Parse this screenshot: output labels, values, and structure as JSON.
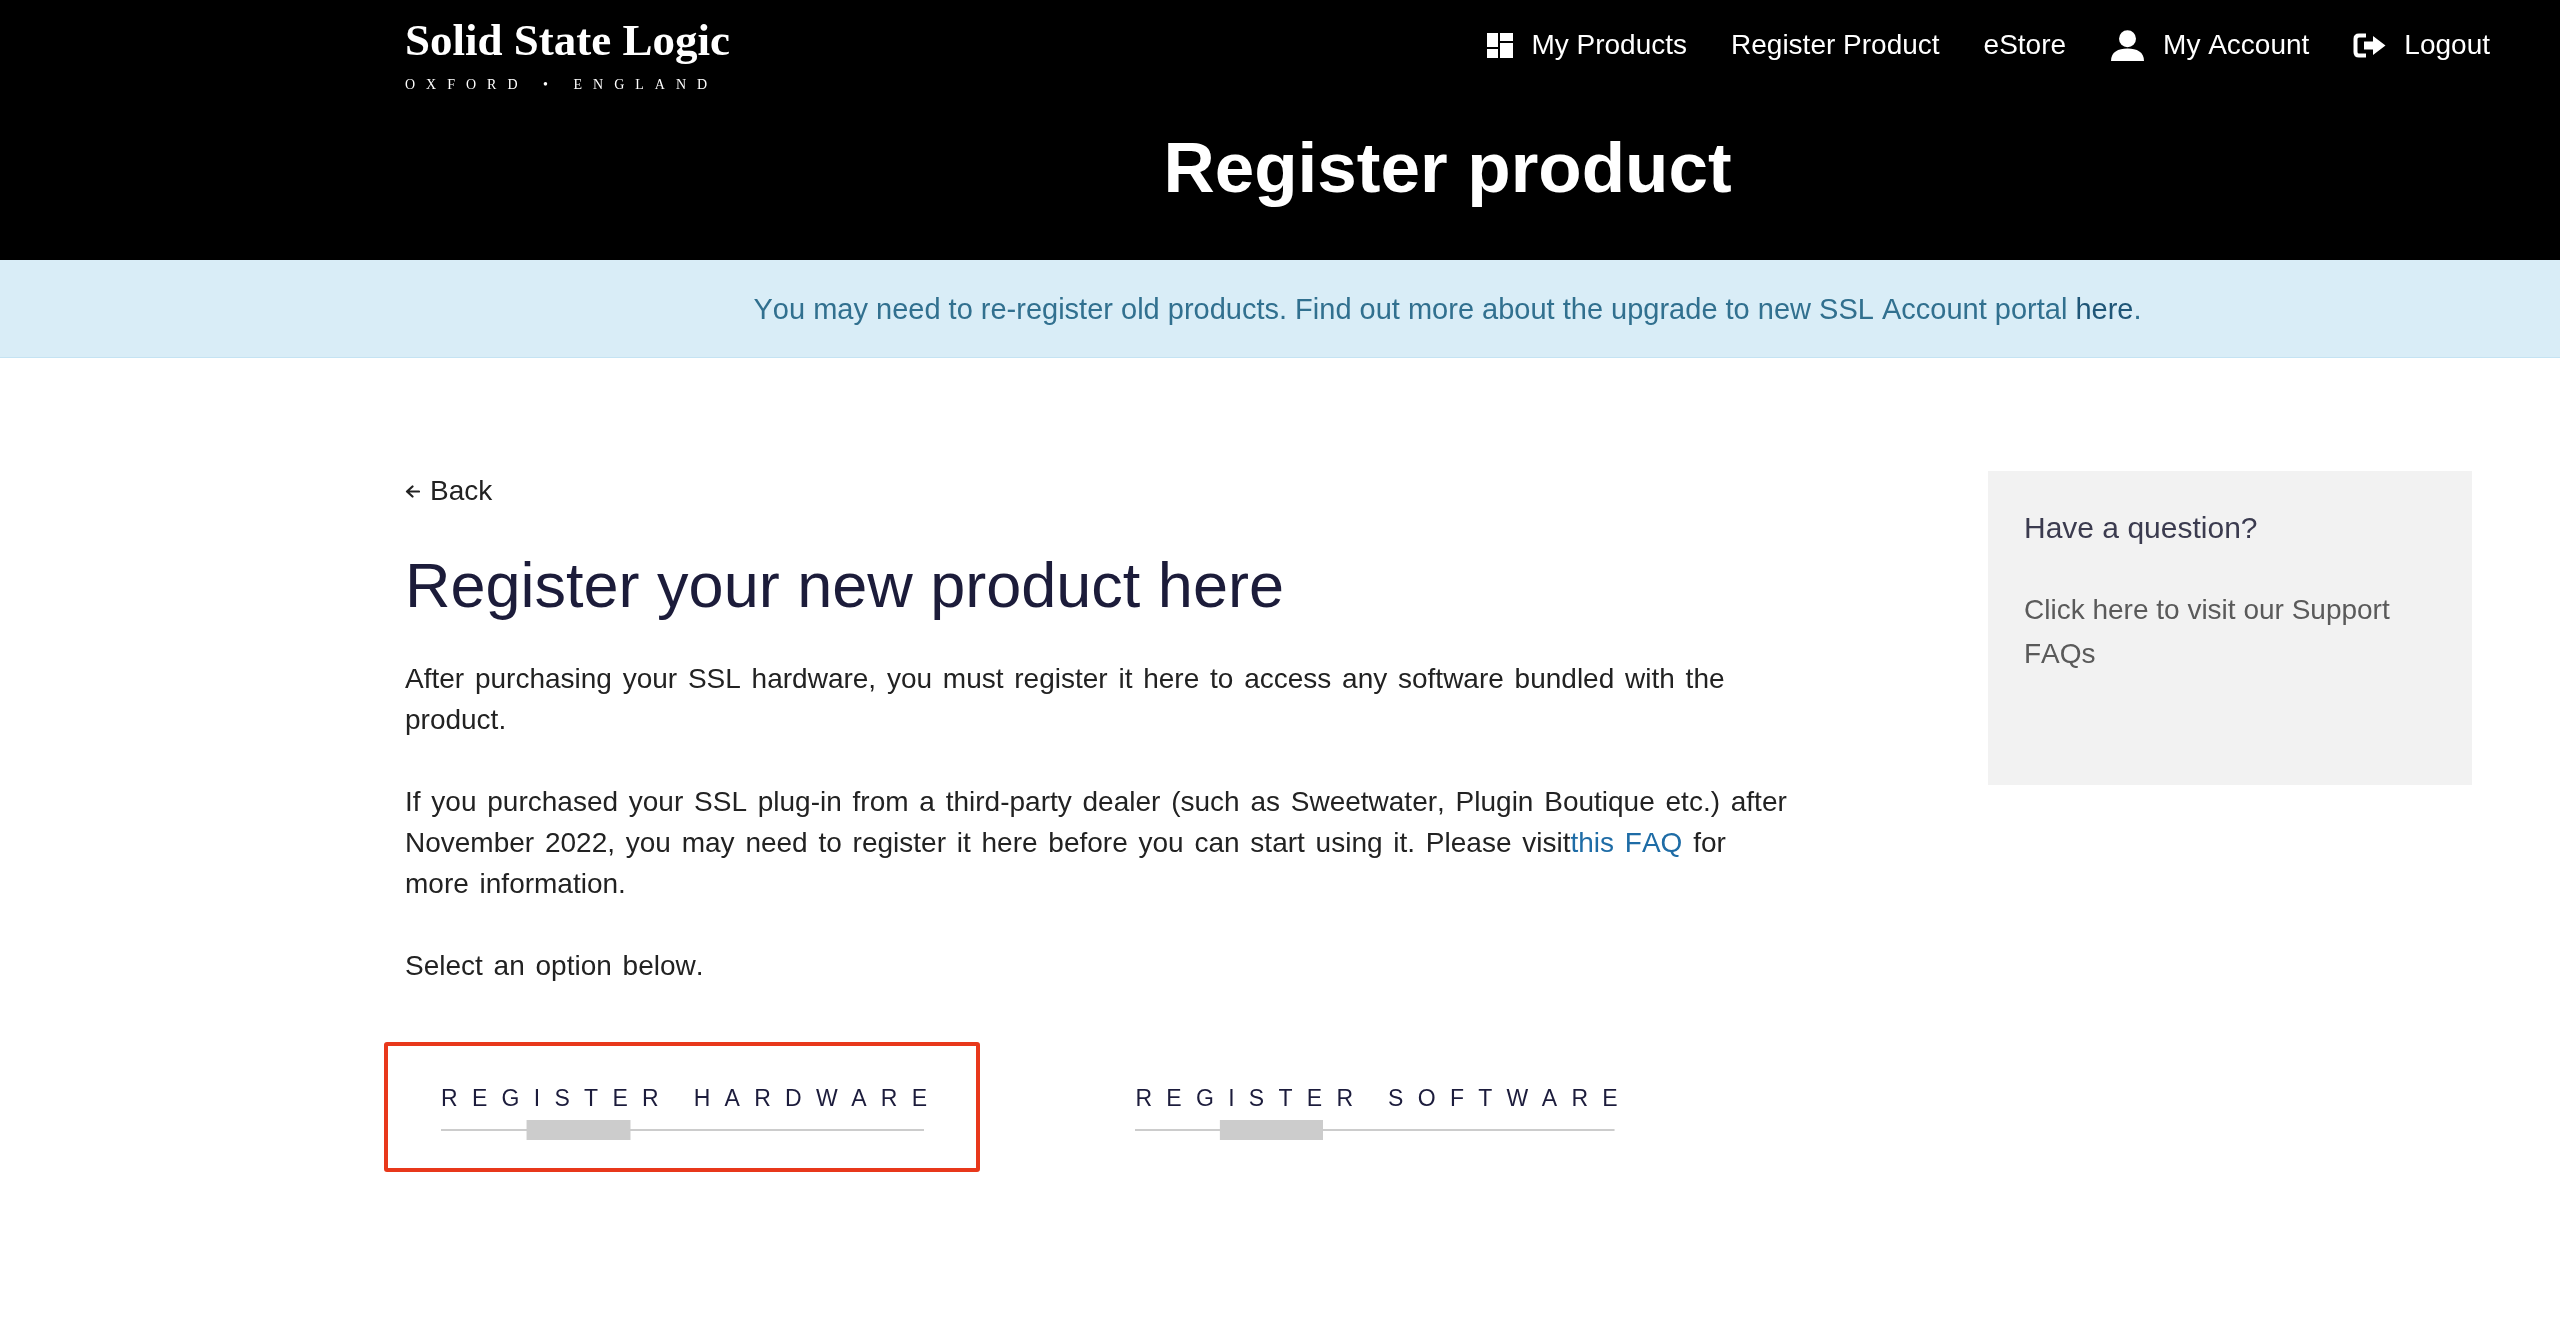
{
  "header": {
    "logo": {
      "name": "Solid State Logic",
      "tagline": "OXFORD • ENGLAND"
    },
    "nav": [
      {
        "label": "My Products",
        "kind": "dashboard"
      },
      {
        "label": "Register Product",
        "kind": "text"
      },
      {
        "label": "eStore",
        "kind": "text"
      },
      {
        "label": "My Account",
        "kind": "account"
      },
      {
        "label": "Logout",
        "kind": "logout"
      }
    ]
  },
  "page_title": "Register product",
  "notice": {
    "before": "You may need to re-register old products. Find out more about the upgrade to new SSL Account portal",
    "link": "here",
    "after": "."
  },
  "back_link": "Back",
  "heading": "Register your new product here",
  "paragraphs": [
    {
      "text": "After purchasing your SSL hardware, you must register it here to access any software bundled with the product."
    },
    {
      "text": "If you purchased your SSL plug-in from a third-party dealer (such as Sweetwater, Plugin Boutique etc.) after November 2022, you may need to register it here before you can start using it. Please visit",
      "link": "this FAQ",
      "after": " for more information."
    },
    {
      "text": "Select an option below."
    }
  ],
  "options": [
    {
      "label": "REGISTER HARDWARE",
      "selected": true
    },
    {
      "label": "REGISTER SOFTWARE",
      "selected": false
    }
  ],
  "sidebar": {
    "title": "Have a question?",
    "link": "Click here to visit our Support FAQs"
  }
}
